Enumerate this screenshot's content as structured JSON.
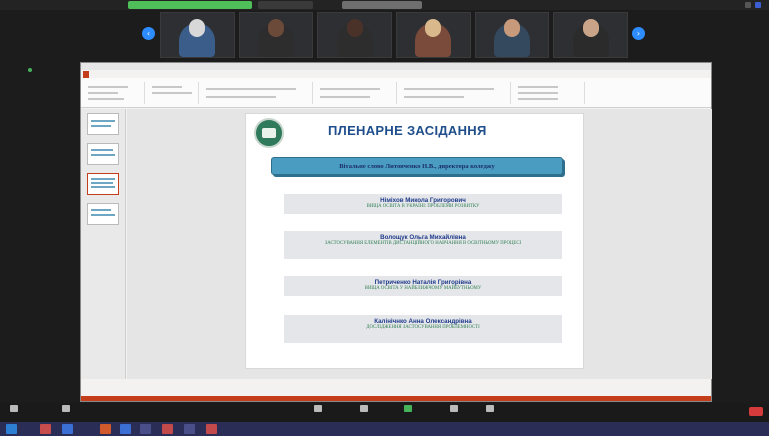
{
  "share_bar": {
    "pill_green": "",
    "pill_dark": "",
    "pill_grey": ""
  },
  "participants": [
    {
      "name": "",
      "shirt": "#3b5d8a"
    },
    {
      "name": "",
      "shirt": "#2d2d2d"
    },
    {
      "name": "",
      "shirt": "#2d2d2d"
    },
    {
      "name": "",
      "shirt": "#7a4a3a"
    },
    {
      "name": "",
      "shirt": "#34495e"
    },
    {
      "name": "",
      "shirt": "#2b2b2b"
    }
  ],
  "ppt": {
    "window_title": "",
    "tabs": [
      "",
      "",
      "",
      "",
      "",
      "",
      "",
      "",
      ""
    ],
    "notes": ""
  },
  "slide": {
    "title": "ПЛЕНАРНЕ ЗАСІДАННЯ",
    "banner": "Вітальне слово Литовченко Н.В., директора коледжу",
    "speakers": [
      {
        "name": "Німіхов Микола Григорович",
        "topic": "ВИЩА ОСВІТА В УКРАЇНІ: ПРОБЛЕМИ РОЗВИТКУ"
      },
      {
        "name": "Волощук Ольга Михайлівна",
        "topic": "ЗАСТОСУВАННЯ ЕЛЕМЕНТІВ ДИСТАНЦІЙНОГО НАВЧАННЯ В ОСВІТНЬОМУ ПРОЦЕСІ"
      },
      {
        "name": "Петриченко Наталія Григорівна",
        "topic": "ВИЩА ОСВІТА У НАЙБЛИЖЧОМУ МАЙБУТНЬОМУ"
      },
      {
        "name": "Калінічнко Анна Олександрівна",
        "topic": "ДОСЛІДЖЕННЯ ЗАСТОСУВАННЯ ПРОБЛЕМНОСТІ"
      }
    ]
  },
  "colors": {
    "accent": "#2d8cff",
    "title": "#1f4e8c",
    "banner": "#4a9cc0",
    "topic": "#2e7d4f",
    "ppt_red": "#c43e1c"
  }
}
